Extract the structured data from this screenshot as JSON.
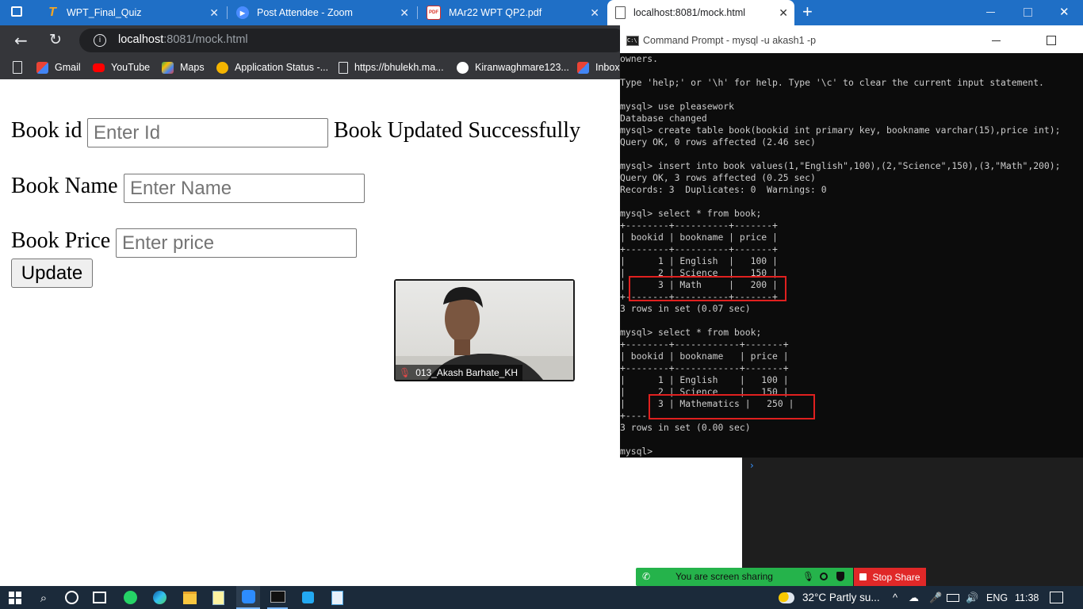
{
  "browser": {
    "tabs": [
      {
        "title": "WPT_Final_Quiz",
        "icon": "testbook-icon"
      },
      {
        "title": "Post Attendee - Zoom",
        "icon": "zoom-icon"
      },
      {
        "title": "MAr22 WPT QP2.pdf",
        "icon": "pdf-icon"
      },
      {
        "title": "localhost:8081/mock.html",
        "icon": "page-icon"
      }
    ],
    "new_tab": "+",
    "url_host": "localhost",
    "url_rest": ":8081/mock.html",
    "bookmarks": [
      {
        "label": "Gmail",
        "icon": "gmail-icon",
        "color": "#ea4335"
      },
      {
        "label": "YouTube",
        "icon": "youtube-icon",
        "color": "#ff0000"
      },
      {
        "label": "Maps",
        "icon": "maps-icon",
        "color": "#34a853"
      },
      {
        "label": "Application Status -...",
        "icon": "status-icon",
        "color": "#f4b400"
      },
      {
        "label": "https://bhulekh.ma...",
        "icon": "page-icon",
        "color": "#ffffff"
      },
      {
        "label": "Kiranwaghmare123...",
        "icon": "github-icon",
        "color": "#ffffff"
      },
      {
        "label": "Inbox",
        "icon": "gmail-icon",
        "color": "#ea4335"
      }
    ]
  },
  "page": {
    "book_id_label": "Book id",
    "book_id_placeholder": "Enter Id",
    "status_message": "Book Updated Successfully",
    "book_name_label": "Book Name",
    "book_name_placeholder": "Enter Name",
    "book_price_label": "Book Price",
    "book_price_placeholder": "Enter price",
    "update_button": "Update"
  },
  "zoom": {
    "participant_name": "013_Akash Barhate_KH",
    "sharing_text": "You are screen sharing",
    "stop_share": "Stop Share"
  },
  "cmd": {
    "title": "Command Prompt - mysql  -u akash1 -p",
    "lines": [
      "owners.",
      "",
      "Type 'help;' or '\\h' for help. Type '\\c' to clear the current input statement.",
      "",
      "mysql> use pleasework",
      "Database changed",
      "mysql> create table book(bookid int primary key, bookname varchar(15),price int);",
      "Query OK, 0 rows affected (2.46 sec)",
      "",
      "mysql> insert into book values(1,\"English\",100),(2,\"Science\",150),(3,\"Math\",200);",
      "Query OK, 3 rows affected (0.25 sec)",
      "Records: 3  Duplicates: 0  Warnings: 0",
      "",
      "mysql> select * from book;",
      "+--------+----------+-------+",
      "| bookid | bookname | price |",
      "+--------+----------+-------+",
      "|      1 | English  |   100 |",
      "|      2 | Science  |   150 |",
      "|      3 | Math     |   200 |",
      "+--------+----------+-------+",
      "3 rows in set (0.07 sec)",
      "",
      "mysql> select * from book;",
      "+--------+------------+-------+",
      "| bookid | bookname   | price |",
      "+--------+------------+-------+",
      "|      1 | English    |   100 |",
      "|      2 | Science    |   150 |",
      "|      3 | Mathematics |   250 |",
      "+----",
      "3 rows in set (0.00 sec)",
      "",
      "mysql>"
    ]
  },
  "taskbar": {
    "weather": "32°C  Partly su...",
    "language": "ENG",
    "time": "11:38"
  }
}
